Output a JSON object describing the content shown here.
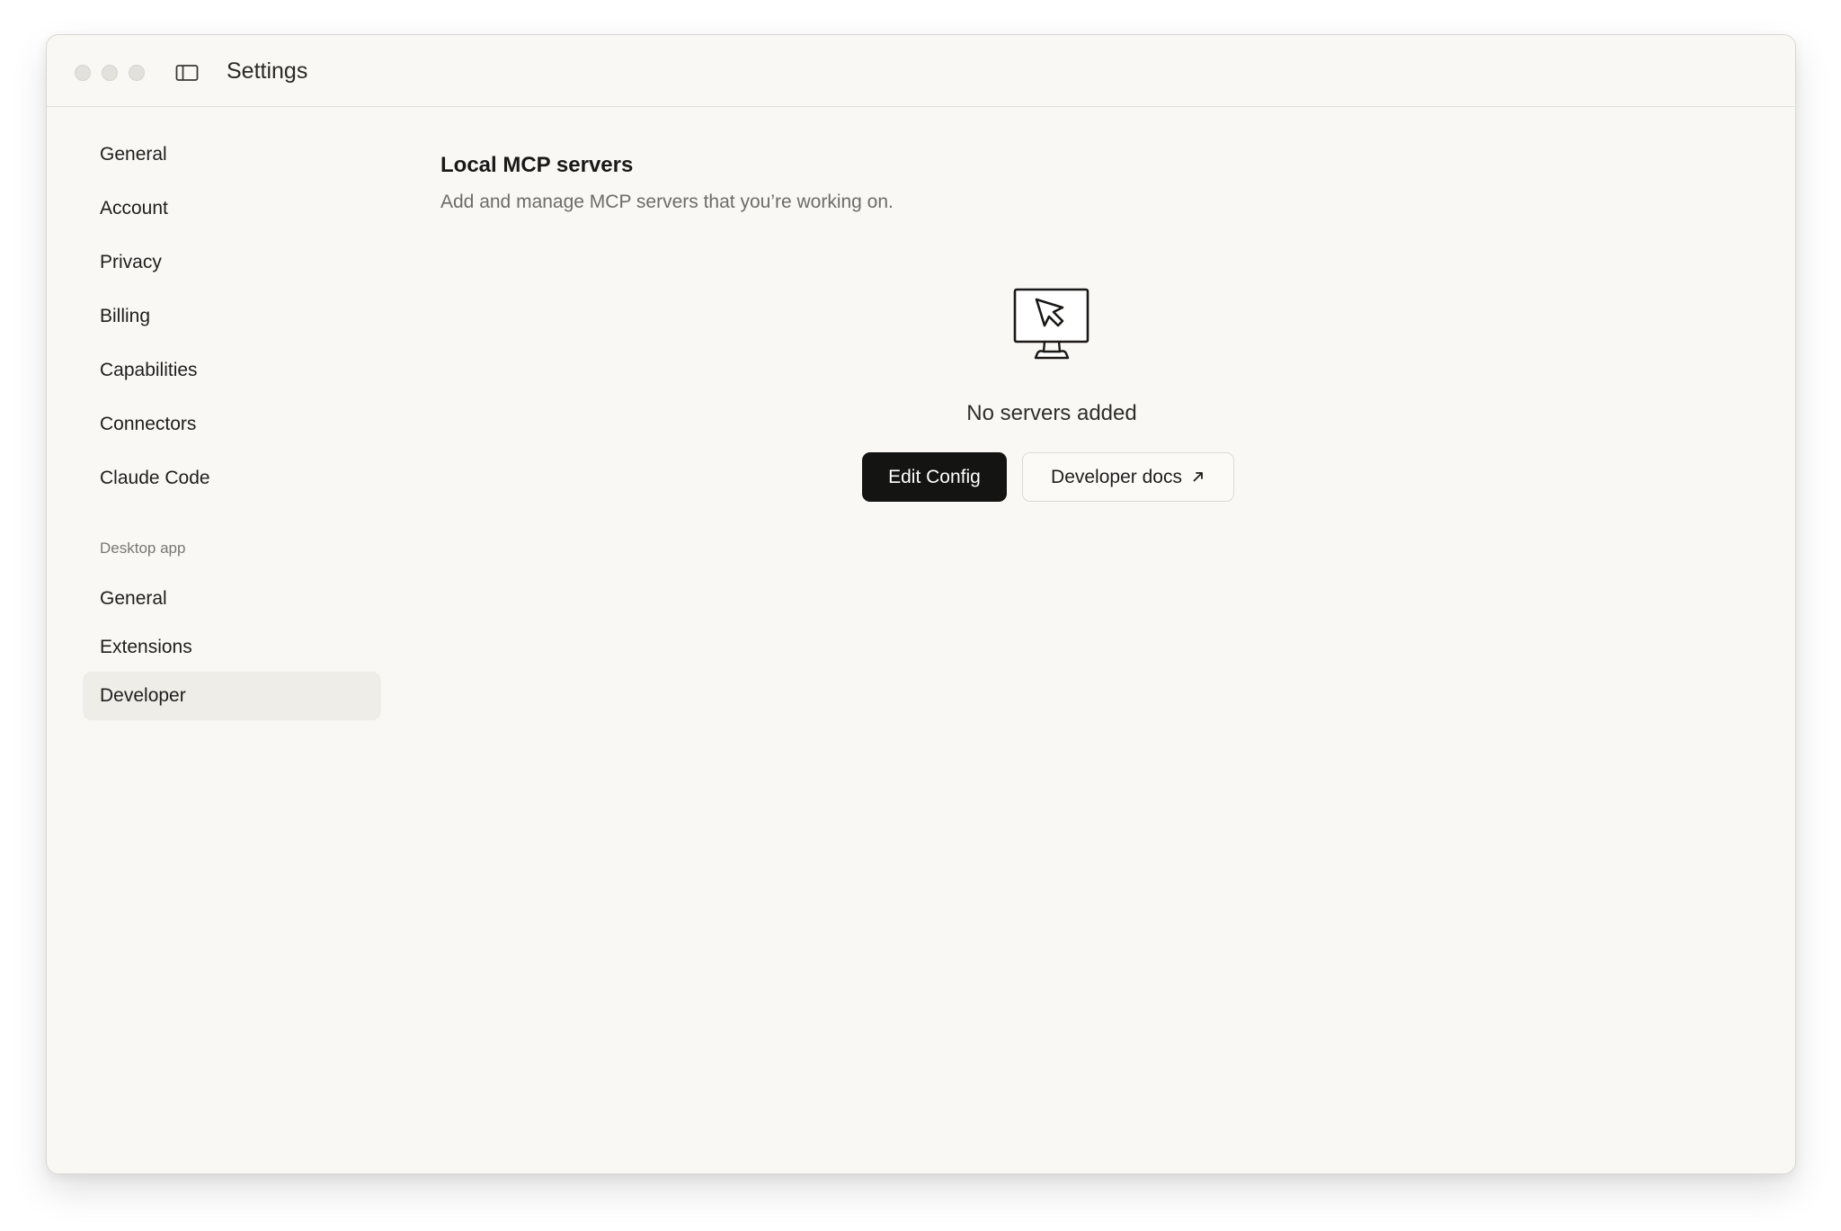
{
  "window": {
    "title": "Settings"
  },
  "sidebar": {
    "items": [
      {
        "label": "General"
      },
      {
        "label": "Account"
      },
      {
        "label": "Privacy"
      },
      {
        "label": "Billing"
      },
      {
        "label": "Capabilities"
      },
      {
        "label": "Connectors"
      },
      {
        "label": "Claude Code"
      }
    ],
    "desktop_section": {
      "label": "Desktop app",
      "items": [
        {
          "label": "General"
        },
        {
          "label": "Extensions"
        },
        {
          "label": "Developer",
          "active": true
        }
      ]
    }
  },
  "main": {
    "title": "Local MCP servers",
    "subtitle": "Add and manage MCP servers that you’re working on.",
    "empty_state": {
      "icon": "monitor-cursor-icon",
      "text": "No servers added"
    },
    "buttons": {
      "edit_config": "Edit Config",
      "developer_docs": "Developer docs"
    }
  },
  "colors": {
    "window_bg": "#f9f8f5",
    "primary_button_bg": "#141413",
    "active_nav_bg": "#eeede8"
  }
}
